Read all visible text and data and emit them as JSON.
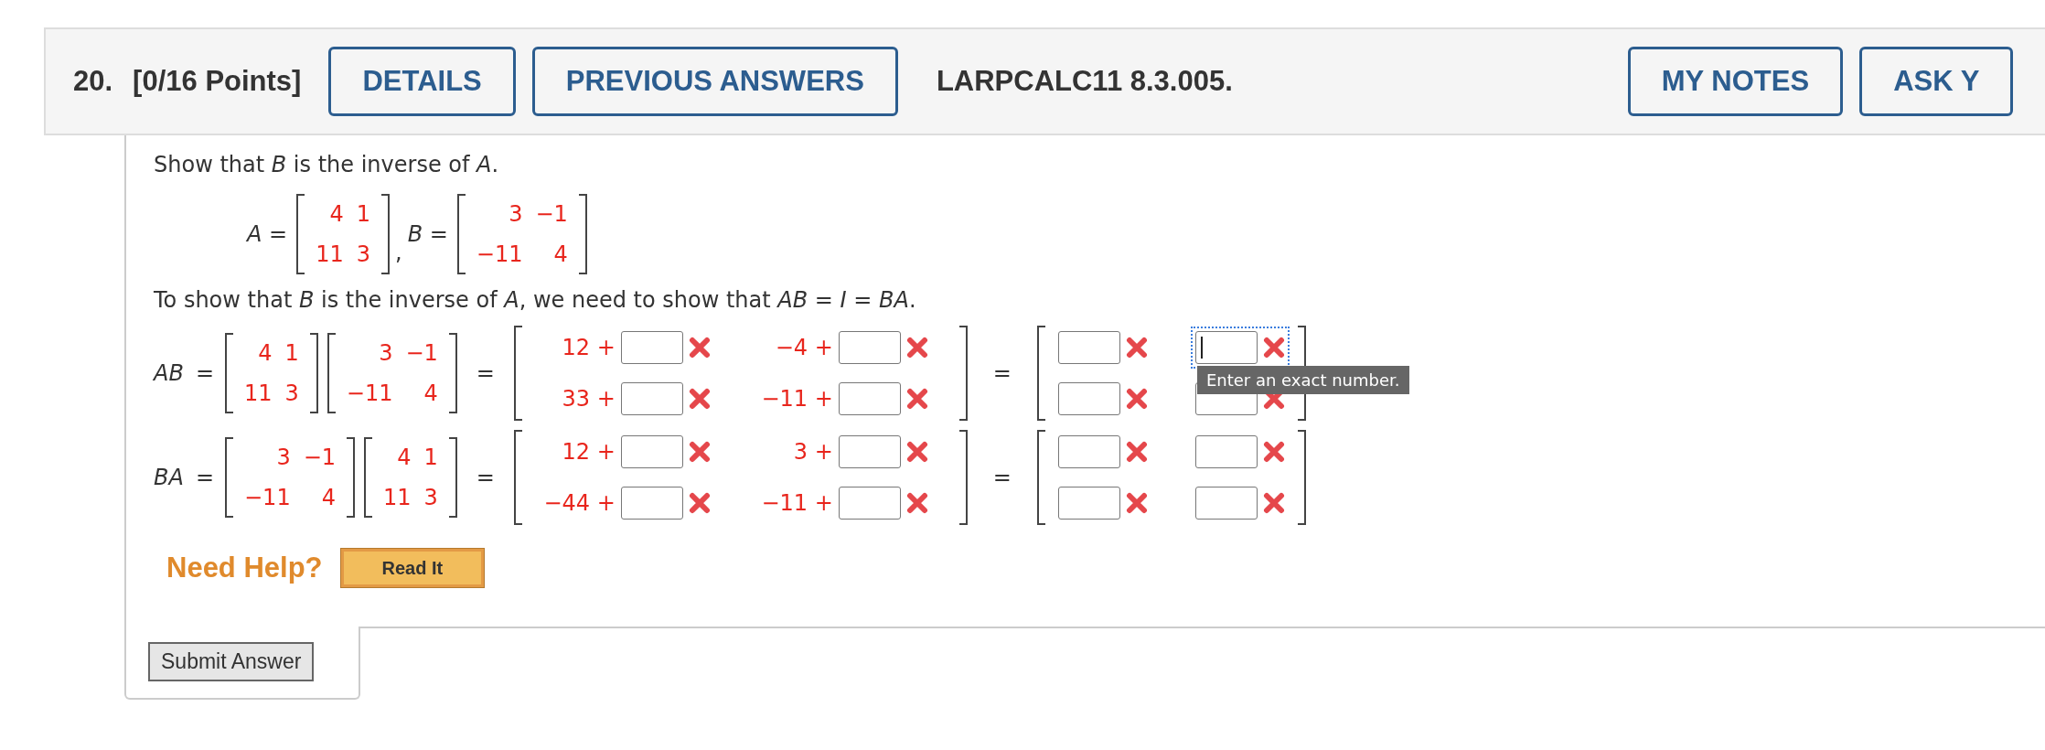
{
  "header": {
    "number": "20.",
    "points": "[0/16 Points]",
    "buttons": [
      "DETAILS",
      "PREVIOUS ANSWERS"
    ],
    "reference": "LARPCALC11 8.3.005.",
    "right_buttons": [
      "MY NOTES",
      "ASK Y"
    ]
  },
  "prompt": "Show that *B* is the inverse of *A*.",
  "given": [
    {
      "label": "A =",
      "matrix": [
        [
          "4",
          "1"
        ],
        [
          "11",
          "3"
        ]
      ],
      "separator": ","
    },
    {
      "label": "B =",
      "matrix": [
        [
          "3",
          "−1"
        ],
        [
          "−11",
          "4"
        ]
      ]
    }
  ],
  "statement": "To show that *B* is the inverse of *A*, we need to show that *AB* = *I* = *BA*.",
  "products": [
    {
      "label": "AB",
      "equals": [
        "=",
        "=",
        "="
      ],
      "factors": [
        [
          [
            "4",
            "1"
          ],
          [
            "11",
            "3"
          ]
        ],
        [
          [
            "3",
            "−1"
          ],
          [
            "−11",
            "4"
          ]
        ]
      ],
      "expanded": [
        [
          {
            "prefix": "12 +",
            "correct": false
          },
          {
            "prefix": "−4 +",
            "correct": false
          }
        ],
        [
          {
            "prefix": "33 +",
            "correct": false
          },
          {
            "prefix": "−11 +",
            "correct": false
          }
        ]
      ],
      "result": [
        [
          {
            "correct": false,
            "focused": false
          },
          {
            "correct": false,
            "focused": true,
            "tooltip": "Enter an exact number."
          }
        ],
        [
          {
            "correct": false,
            "focused": false
          },
          {
            "correct": false,
            "focused": false
          }
        ]
      ]
    },
    {
      "label": "BA",
      "equals": [
        "=",
        "=",
        "="
      ],
      "factors": [
        [
          [
            "3",
            "−1"
          ],
          [
            "−11",
            "4"
          ]
        ],
        [
          [
            "4",
            "1"
          ],
          [
            "11",
            "3"
          ]
        ]
      ],
      "expanded": [
        [
          {
            "prefix": "12 +",
            "correct": false
          },
          {
            "prefix": "3 +",
            "correct": false
          }
        ],
        [
          {
            "prefix": "−44 +",
            "correct": false
          },
          {
            "prefix": "−11 +",
            "correct": false
          }
        ]
      ],
      "result": [
        [
          {
            "correct": false,
            "focused": false
          },
          {
            "correct": false,
            "focused": false
          }
        ],
        [
          {
            "correct": false,
            "focused": false
          },
          {
            "correct": false,
            "focused": false
          }
        ]
      ]
    }
  ],
  "help": {
    "label": "Need Help?",
    "button": "Read It"
  },
  "submit": "Submit Answer"
}
